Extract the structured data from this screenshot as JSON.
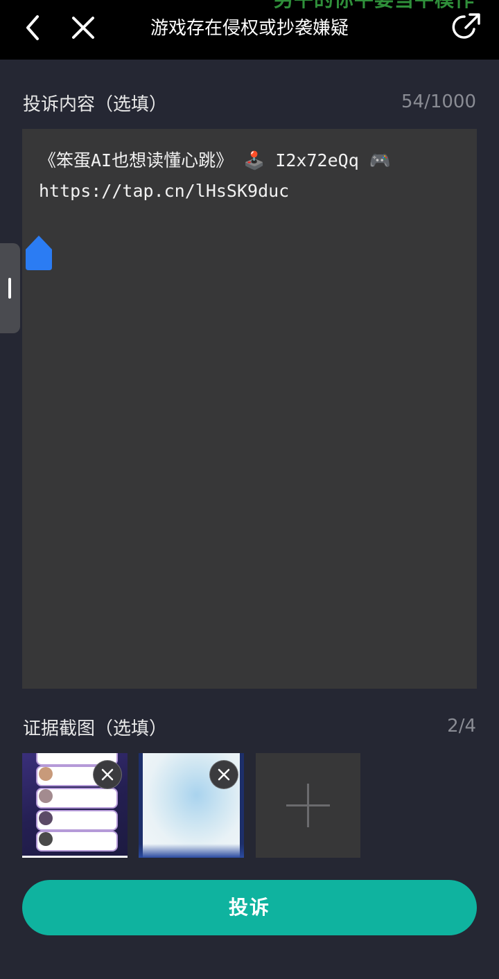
{
  "topbar": {
    "overlay_text": "另午的你平要当平模作",
    "title": "游戏存在侵权或抄袭嫌疑",
    "icons": [
      "back-icon",
      "close-icon",
      "share-icon"
    ]
  },
  "complaint": {
    "label": "投诉内容（选填）",
    "counter": "54/1000",
    "content": "《笨蛋AI也想读懂心跳》 🕹️ I2x72eQq 🎮\nhttps://tap.cn/lHsSK9duc"
  },
  "evidence": {
    "label": "证据截图（选填）",
    "counter": "2/4",
    "thumbnails": [
      "chat-screenshot",
      "sparkle-screenshot"
    ],
    "add_icon": "plus-icon"
  },
  "submit": {
    "label": "投诉"
  },
  "colors": {
    "background": "#252733",
    "topbar": "#000000",
    "textarea": "#373738",
    "accent": "#0fb39f",
    "cursor_handle": "#2b7cf3"
  }
}
